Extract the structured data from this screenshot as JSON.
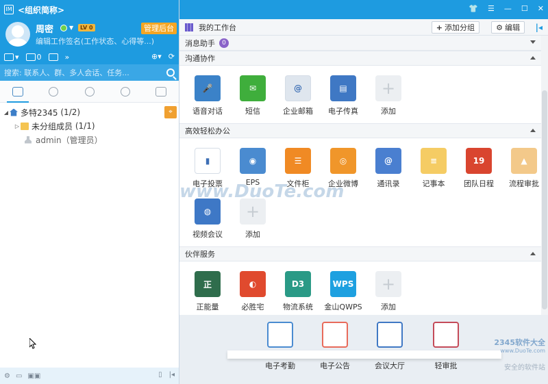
{
  "app": {
    "org_name": "<组织简称>",
    "logo_text": "IM"
  },
  "user": {
    "name": "周密",
    "level": "LV 0",
    "signature": "编辑工作签名(工作状态、心得等...)",
    "admin_button": "管理后台"
  },
  "toolbar": {
    "mail_count": "0"
  },
  "search": {
    "placeholder": "搜索: 联系人、群、多人会话、任务..."
  },
  "tree": {
    "root": "多特2345",
    "root_count": "(1/2)",
    "group": "未分组成员",
    "group_count": "(1/1)",
    "member": "admin（管理员）"
  },
  "workspace": {
    "title": "我的工作台",
    "add_group": "添加分组",
    "edit": "编辑"
  },
  "sections": {
    "messages": {
      "title": "消息助手",
      "badge": "0"
    },
    "communication": {
      "title": "沟通协作",
      "apps": [
        {
          "label": "语音对话",
          "color": "#3b82c8",
          "glyph": "🎤"
        },
        {
          "label": "短信",
          "color": "#3fae3c",
          "glyph": "✉"
        },
        {
          "label": "企业邮箱",
          "color": "#dfe6ee",
          "glyph": "@"
        },
        {
          "label": "电子传真",
          "color": "#3f78c4",
          "glyph": "▤"
        },
        {
          "label": "添加",
          "color": "add",
          "glyph": "+"
        }
      ]
    },
    "office": {
      "title": "高效轻松办公",
      "apps": [
        {
          "label": "电子投票",
          "color": "#ffffff",
          "glyph": "▮"
        },
        {
          "label": "EPS",
          "color": "#4a8bd0",
          "glyph": "◉"
        },
        {
          "label": "文件柜",
          "color": "#f08a24",
          "glyph": "☰"
        },
        {
          "label": "企业微博",
          "color": "#f0962a",
          "glyph": "◎"
        },
        {
          "label": "通讯录",
          "color": "#4a7fd0",
          "glyph": "@"
        },
        {
          "label": "记事本",
          "color": "#f5cc64",
          "glyph": "≡"
        },
        {
          "label": "团队日程",
          "color": "#d9452f",
          "glyph": "19"
        },
        {
          "label": "流程审批",
          "color": "#f3c98a",
          "glyph": "▲"
        },
        {
          "label": "视频会议",
          "color": "#3e78c6",
          "glyph": "◍"
        },
        {
          "label": "添加",
          "color": "add",
          "glyph": "+"
        }
      ]
    },
    "partners": {
      "title": "伙伴服务",
      "apps": [
        {
          "label": "正能量",
          "color": "#2f6d4c",
          "glyph": "正"
        },
        {
          "label": "必胜宅",
          "color": "#e04a2e",
          "glyph": "◐"
        },
        {
          "label": "物流系统",
          "color": "#2a9a86",
          "glyph": "D3"
        },
        {
          "label": "金山QWPS",
          "color": "#1ea0e0",
          "glyph": "WPS"
        },
        {
          "label": "添加",
          "color": "add",
          "glyph": "+"
        }
      ]
    }
  },
  "dock": [
    {
      "label": "电子考勤",
      "color": "#4a8bd0"
    },
    {
      "label": "电子公告",
      "color": "#e86a5a"
    },
    {
      "label": "会议大厅",
      "color": "#3f78c4"
    },
    {
      "label": "轻审批",
      "color": "#c44a58"
    }
  ],
  "watermark": {
    "main": "www.DuoTe.com",
    "brand": "2345软件大全",
    "url": "www.DuoTe.com",
    "slogan": "安全的软件站"
  }
}
